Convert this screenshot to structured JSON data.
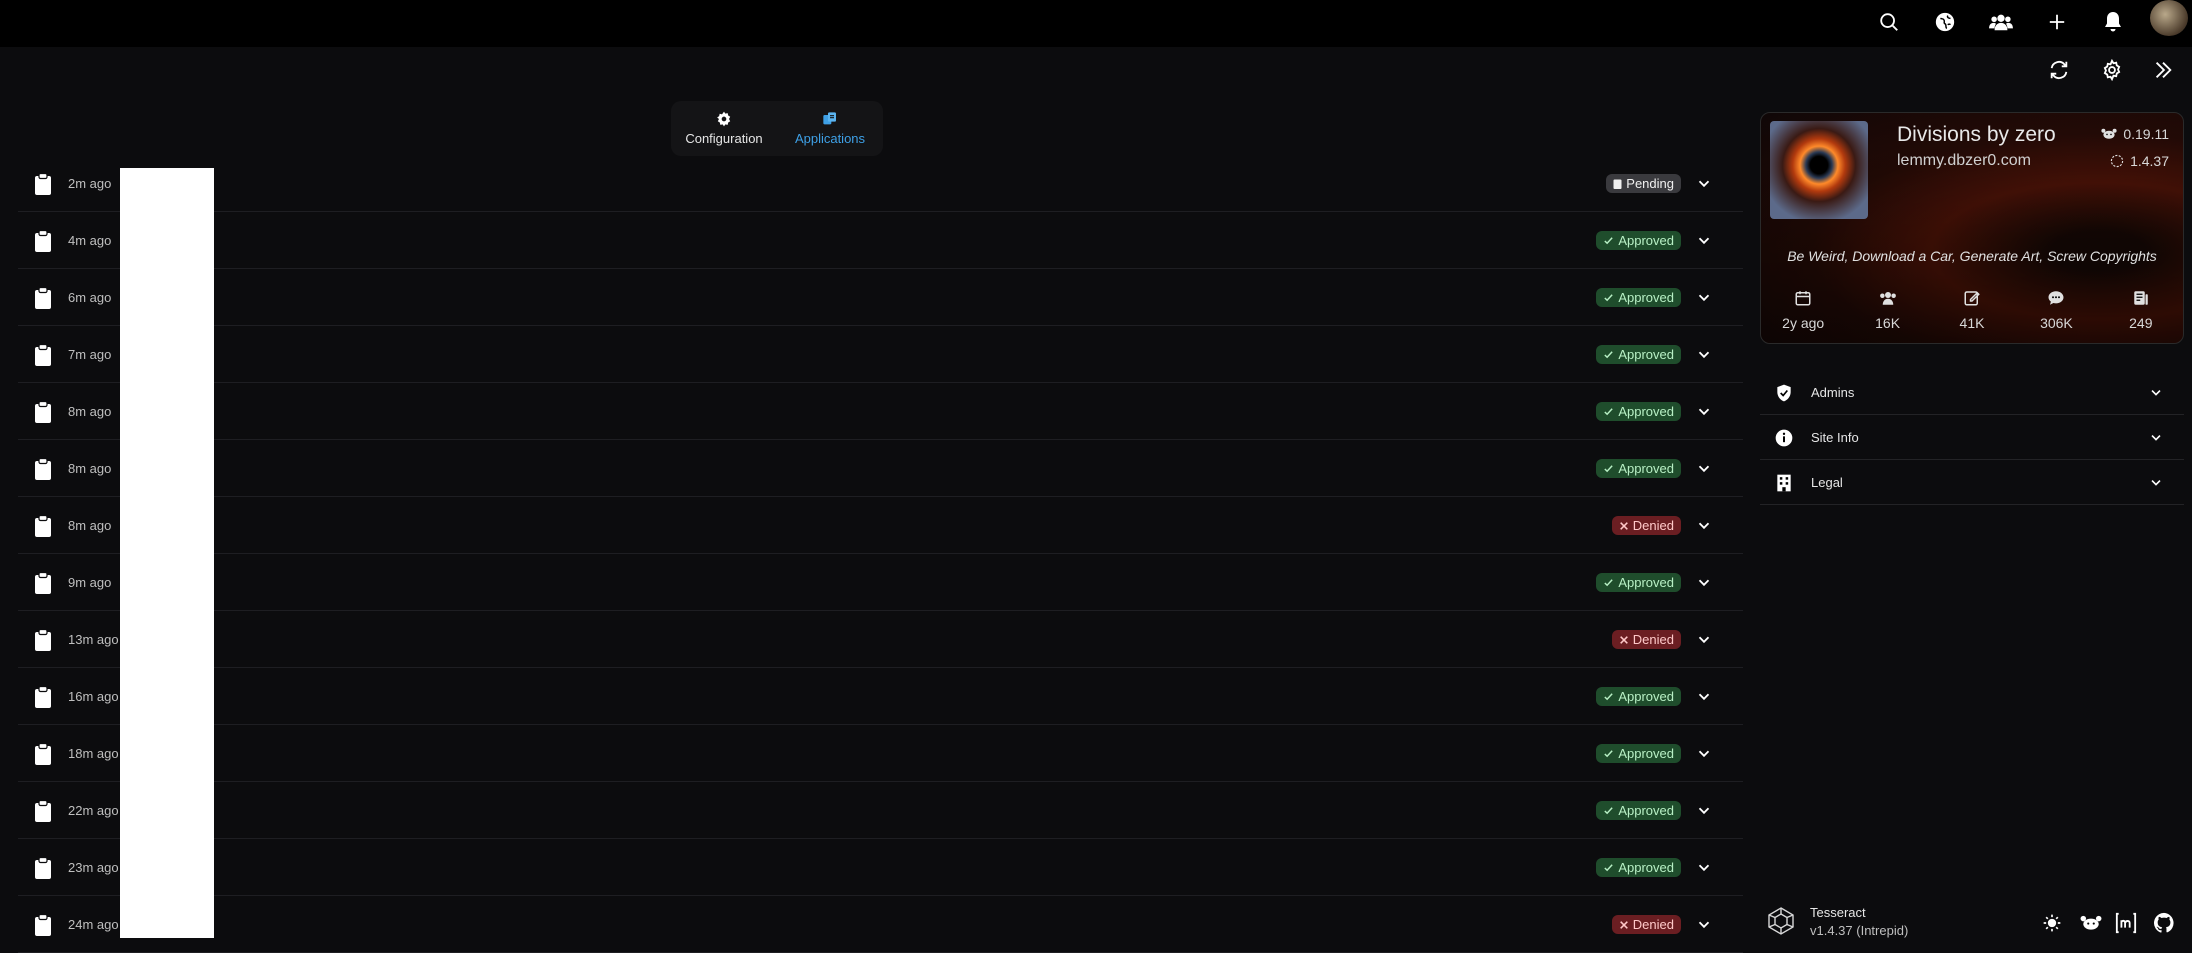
{
  "topbar": {
    "icons": [
      "search-icon",
      "globe-icon",
      "users-icon",
      "plus-icon",
      "bell-icon",
      "avatar"
    ]
  },
  "secondary_bar": {
    "icons": [
      "refresh-icon",
      "gear-icon",
      "double-chevron-right-icon"
    ]
  },
  "tabs": [
    {
      "label": "Configuration",
      "icon": "gear-icon",
      "active": false
    },
    {
      "label": "Applications",
      "icon": "applications-icon",
      "active": true
    }
  ],
  "applications": [
    {
      "time": "2m ago",
      "status": "Pending"
    },
    {
      "time": "4m ago",
      "status": "Approved"
    },
    {
      "time": "6m ago",
      "status": "Approved"
    },
    {
      "time": "7m ago",
      "status": "Approved"
    },
    {
      "time": "8m ago",
      "status": "Approved"
    },
    {
      "time": "8m ago",
      "status": "Approved"
    },
    {
      "time": "8m ago",
      "status": "Denied"
    },
    {
      "time": "9m ago",
      "status": "Approved"
    },
    {
      "time": "13m ago",
      "status": "Denied"
    },
    {
      "time": "16m ago",
      "status": "Approved"
    },
    {
      "time": "18m ago",
      "status": "Approved"
    },
    {
      "time": "22m ago",
      "status": "Approved"
    },
    {
      "time": "23m ago",
      "status": "Approved"
    },
    {
      "time": "24m ago",
      "status": "Denied"
    }
  ],
  "site_card": {
    "name": "Divisions by zero",
    "host": "lemmy.dbzer0.com",
    "lemmy_version": "0.19.11",
    "ui_version": "1.4.37",
    "tagline": "Be Weird, Download a Car, Generate Art, Screw Copyrights",
    "stats": [
      {
        "icon": "calendar-icon",
        "value": "2y ago"
      },
      {
        "icon": "users-icon",
        "value": "16K"
      },
      {
        "icon": "edit-icon",
        "value": "41K"
      },
      {
        "icon": "comment-icon",
        "value": "306K"
      },
      {
        "icon": "posts-icon",
        "value": "249"
      }
    ]
  },
  "accordions": [
    {
      "label": "Admins",
      "icon": "shield-check-icon"
    },
    {
      "label": "Site Info",
      "icon": "info-icon"
    },
    {
      "label": "Legal",
      "icon": "building-icon"
    }
  ],
  "footer": {
    "app_name": "Tesseract",
    "version": "v1.4.37 (Intrepid)",
    "icons": [
      "sun-icon",
      "lemmy-icon",
      "matrix-icon",
      "github-icon"
    ]
  },
  "colors": {
    "accent": "#3ea0e6",
    "approved_bg": "#1f4d2c",
    "denied_bg": "#6b1e22",
    "pending_bg": "#3a3a3e"
  }
}
